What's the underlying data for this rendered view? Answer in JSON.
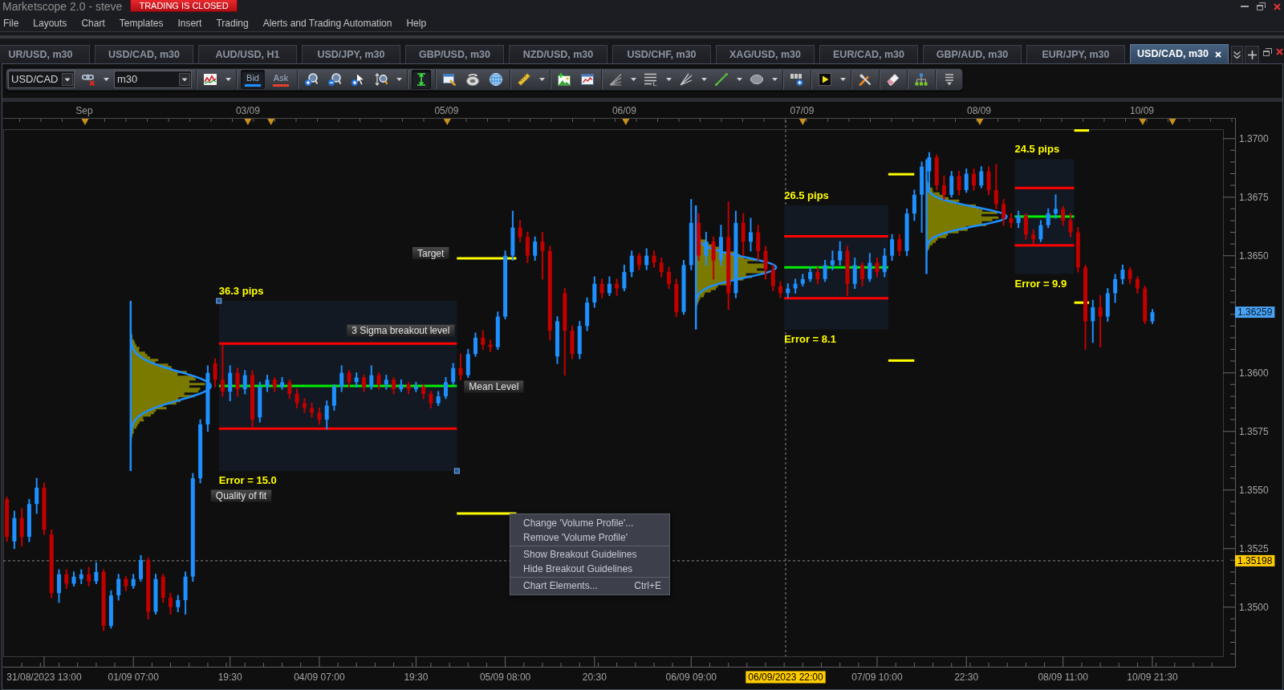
{
  "window": {
    "title": "Marketscope 2.0 - steve",
    "status_badge": "TRADING IS CLOSED"
  },
  "menu": [
    "File",
    "Layouts",
    "Chart",
    "Templates",
    "Insert",
    "Trading",
    "Alerts and Trading Automation",
    "Help"
  ],
  "tabs": [
    {
      "label": "UR/USD, m30",
      "selected": false
    },
    {
      "label": "USD/CAD, m30",
      "selected": false
    },
    {
      "label": "AUD/USD, H1",
      "selected": false
    },
    {
      "label": "USD/JPY, m30",
      "selected": false
    },
    {
      "label": "GBP/USD, m30",
      "selected": false
    },
    {
      "label": "NZD/USD, m30",
      "selected": false
    },
    {
      "label": "USD/CHF, m30",
      "selected": false
    },
    {
      "label": "XAG/USD, m30",
      "selected": false
    },
    {
      "label": "EUR/CAD, m30",
      "selected": false
    },
    {
      "label": "GBP/AUD, m30",
      "selected": false
    },
    {
      "label": "EUR/JPY, m30",
      "selected": false
    },
    {
      "label": "USD/CAD, m30",
      "selected": true
    }
  ],
  "toolbar": {
    "symbol": "USD/CAD",
    "timeframe": "m30",
    "price_modes": [
      {
        "label": "Bid",
        "selected": true,
        "color": "#1e90ff"
      },
      {
        "label": "Ask",
        "selected": false,
        "color": "#e8402a"
      }
    ],
    "vertical_fit_on": true
  },
  "chart": {
    "date_ruler": [
      "Sep",
      "03/09",
      "05/09",
      "06/09",
      "07/09",
      "08/09",
      "10/09"
    ],
    "chart_data": [
      {
        "type": "candlestick",
        "ylim": [
          1.3479,
          1.3704
        ],
        "yticks": [
          {
            "value": 1.35,
            "label": "1.3500"
          },
          {
            "value": 1.3525,
            "label": "1.3525"
          },
          {
            "value": 1.355,
            "label": "1.3550"
          },
          {
            "value": 1.3575,
            "label": "1.3575"
          },
          {
            "value": 1.36,
            "label": "1.3600"
          },
          {
            "value": 1.365,
            "label": "1.3650"
          },
          {
            "value": 1.3675,
            "label": "1.3675"
          },
          {
            "value": 1.37,
            "label": "1.3700"
          }
        ],
        "categories": [
          null,
          null,
          null,
          null,
          null,
          "31/08/2023 13:00",
          null,
          null,
          null,
          null,
          null,
          null,
          null,
          null,
          null,
          null,
          null,
          "01/09 07:00",
          null,
          null,
          null,
          null,
          null,
          null,
          null,
          null,
          null,
          null,
          null,
          null,
          "19:30",
          null,
          null,
          null,
          null,
          null,
          null,
          null,
          null,
          null,
          null,
          null,
          "04/09 07:00",
          null,
          null,
          null,
          null,
          null,
          null,
          null,
          null,
          null,
          null,
          null,
          null,
          "19:30",
          null,
          null,
          null,
          null,
          null,
          null,
          null,
          null,
          null,
          null,
          null,
          "05/09 08:00",
          null,
          null,
          null,
          null,
          null,
          null,
          null,
          null,
          null,
          null,
          null,
          "20:30",
          null,
          null,
          null,
          null,
          null,
          null,
          null,
          null,
          null,
          null,
          null,
          null,
          "06/09 09:00",
          null,
          null,
          null,
          null,
          null,
          null,
          null,
          null,
          null,
          null,
          null,
          null,
          null,
          null,
          null,
          null,
          null,
          null,
          null,
          null,
          null,
          null,
          null,
          null,
          "07/09 10:00",
          null,
          null,
          null,
          null,
          null,
          null,
          null,
          null,
          null,
          null,
          null,
          "22:30",
          null,
          null,
          null,
          null,
          null,
          null,
          null,
          null,
          null,
          null,
          null,
          null,
          "08/09 11:00",
          null,
          null,
          null,
          null,
          null,
          null,
          null,
          null,
          null,
          null,
          null,
          "10/09 21:30",
          null,
          null,
          null,
          null,
          null,
          null,
          null,
          null,
          null
        ],
        "ref_lines": [
          {
            "axis": "y",
            "value": 1.35198,
            "label": "1.35198",
            "line_style": "dashed"
          },
          {
            "axis": "y",
            "value": 1.36125,
            "color": "#ff0000"
          },
          {
            "axis": "y",
            "value": 1.35944,
            "color": "#00ee00"
          },
          {
            "axis": "y",
            "value": 1.35762,
            "color": "#ff0000"
          },
          {
            "axis": "y",
            "value": 1.36583,
            "color": "#ff0000"
          },
          {
            "axis": "y",
            "value": 1.3645,
            "color": "#00ee00"
          },
          {
            "axis": "y",
            "value": 1.36318,
            "color": "#ff0000"
          }
        ],
        "ohlc": [
          [
            1.3546,
            1.3547,
            1.3528,
            1.353
          ],
          [
            1.3528,
            1.3541,
            1.3525,
            1.3538
          ],
          [
            1.3538,
            1.3542,
            1.3526,
            1.353
          ],
          [
            1.353,
            1.3546,
            1.3528,
            1.3544
          ],
          [
            1.3544,
            1.3555,
            1.354,
            1.3551
          ],
          [
            1.3551,
            1.3553,
            1.3531,
            1.3533
          ],
          [
            1.3531,
            1.3533,
            1.3504,
            1.3506
          ],
          [
            1.3506,
            1.3516,
            1.3502,
            1.3514
          ],
          [
            1.3514,
            1.3516,
            1.3508,
            1.351
          ],
          [
            1.351,
            1.3515,
            1.3509,
            1.3513
          ],
          [
            1.3512,
            1.3516,
            1.351,
            1.3514
          ],
          [
            1.3514,
            1.3517,
            1.3509,
            1.3511
          ],
          [
            1.3511,
            1.3519,
            1.351,
            1.3515
          ],
          [
            1.3515,
            1.3516,
            1.349,
            1.3492
          ],
          [
            1.3492,
            1.3507,
            1.3491,
            1.3505
          ],
          [
            1.3505,
            1.3514,
            1.3503,
            1.3512
          ],
          [
            1.3512,
            1.3513,
            1.3507,
            1.3509
          ],
          [
            1.3509,
            1.3514,
            1.3508,
            1.3512
          ],
          [
            1.3512,
            1.3522,
            1.3511,
            1.352
          ],
          [
            1.352,
            1.3521,
            1.3495,
            1.3498
          ],
          [
            1.3498,
            1.3514,
            1.3497,
            1.3512
          ],
          [
            1.3513,
            1.3514,
            1.3502,
            1.3504
          ],
          [
            1.3504,
            1.3506,
            1.3497,
            1.35
          ],
          [
            1.35,
            1.3505,
            1.3498,
            1.3503
          ],
          [
            1.3503,
            1.3515,
            1.3497,
            1.3513
          ],
          [
            1.3513,
            1.3557,
            1.3511,
            1.3555
          ],
          [
            1.3555,
            1.358,
            1.3553,
            1.3578
          ],
          [
            1.3578,
            1.3603,
            1.3575,
            1.36
          ],
          [
            1.3604,
            1.3606,
            1.3594,
            1.3597
          ],
          [
            1.3597,
            1.3612,
            1.359,
            1.3592
          ],
          [
            1.3592,
            1.3603,
            1.3588,
            1.36
          ],
          [
            1.36,
            1.3602,
            1.359,
            1.3593
          ],
          [
            1.3593,
            1.3601,
            1.3591,
            1.3599
          ],
          [
            1.3599,
            1.3601,
            1.3577,
            1.358
          ],
          [
            1.3581,
            1.3596,
            1.3579,
            1.3594
          ],
          [
            1.3594,
            1.3599,
            1.3592,
            1.3597
          ],
          [
            1.3597,
            1.3598,
            1.3592,
            1.3594
          ],
          [
            1.3594,
            1.3598,
            1.3593,
            1.3596
          ],
          [
            1.3596,
            1.3597,
            1.3589,
            1.3591
          ],
          [
            1.3591,
            1.3593,
            1.3585,
            1.3587
          ],
          [
            1.3587,
            1.3589,
            1.3583,
            1.3585
          ],
          [
            1.3585,
            1.3587,
            1.3581,
            1.3583
          ],
          [
            1.3583,
            1.3585,
            1.3578,
            1.358
          ],
          [
            1.358,
            1.3588,
            1.3576,
            1.3586
          ],
          [
            1.3586,
            1.3595,
            1.3584,
            1.3594
          ],
          [
            1.3594,
            1.3603,
            1.3592,
            1.36
          ],
          [
            1.36,
            1.3601,
            1.3594,
            1.3596
          ],
          [
            1.3596,
            1.36,
            1.3594,
            1.3598
          ],
          [
            1.3598,
            1.3599,
            1.3592,
            1.3594
          ],
          [
            1.3594,
            1.3603,
            1.3593,
            1.3599
          ],
          [
            1.3599,
            1.36,
            1.3593,
            1.3595
          ],
          [
            1.3595,
            1.3599,
            1.3593,
            1.3597
          ],
          [
            1.3597,
            1.3598,
            1.3591,
            1.3593
          ],
          [
            1.3593,
            1.3597,
            1.3592,
            1.3595
          ],
          [
            1.3595,
            1.3596,
            1.3591,
            1.3593
          ],
          [
            1.3593,
            1.3596,
            1.3592,
            1.3594
          ],
          [
            1.3594,
            1.3595,
            1.3589,
            1.3591
          ],
          [
            1.3591,
            1.3592,
            1.3585,
            1.3587
          ],
          [
            1.3587,
            1.3592,
            1.3586,
            1.359
          ],
          [
            1.359,
            1.3598,
            1.3589,
            1.3596
          ],
          [
            1.3596,
            1.3604,
            1.3595,
            1.3602
          ],
          [
            1.3602,
            1.3608,
            1.3597,
            1.3599
          ],
          [
            1.3599,
            1.361,
            1.3598,
            1.3608
          ],
          [
            1.3608,
            1.3617,
            1.3607,
            1.3615
          ],
          [
            1.3615,
            1.3618,
            1.361,
            1.3612
          ],
          [
            1.3612,
            1.3614,
            1.3609,
            1.3611
          ],
          [
            1.3611,
            1.3626,
            1.361,
            1.3624
          ],
          [
            1.3624,
            1.3652,
            1.3623,
            1.365
          ],
          [
            1.365,
            1.3669,
            1.3648,
            1.3662
          ],
          [
            1.3662,
            1.3665,
            1.3656,
            1.3658
          ],
          [
            1.3658,
            1.366,
            1.3647,
            1.365
          ],
          [
            1.365,
            1.3658,
            1.3648,
            1.3656
          ],
          [
            1.3656,
            1.366,
            1.364,
            1.3652
          ],
          [
            1.3652,
            1.3654,
            1.3614,
            1.3618
          ],
          [
            1.3607,
            1.3624,
            1.3604,
            1.3622
          ],
          [
            1.3634,
            1.3636,
            1.3599,
            1.3618
          ],
          [
            1.3618,
            1.362,
            1.3606,
            1.3608
          ],
          [
            1.3608,
            1.3622,
            1.3606,
            1.362
          ],
          [
            1.362,
            1.3632,
            1.3618,
            1.363
          ],
          [
            1.363,
            1.3641,
            1.3628,
            1.3638
          ],
          [
            1.3638,
            1.364,
            1.3632,
            1.3634
          ],
          [
            1.3634,
            1.3641,
            1.3633,
            1.3638
          ],
          [
            1.3638,
            1.364,
            1.3633,
            1.3636
          ],
          [
            1.3636,
            1.3646,
            1.3635,
            1.3643
          ],
          [
            1.3643,
            1.3652,
            1.3641,
            1.365
          ],
          [
            1.365,
            1.3651,
            1.3644,
            1.3646
          ],
          [
            1.3646,
            1.3653,
            1.3644,
            1.365
          ],
          [
            1.365,
            1.3652,
            1.3645,
            1.3647
          ],
          [
            1.3647,
            1.3649,
            1.3641,
            1.3643
          ],
          [
            1.3643,
            1.3645,
            1.3636,
            1.3638
          ],
          [
            1.3638,
            1.364,
            1.3624,
            1.3626
          ],
          [
            1.3626,
            1.3648,
            1.3625,
            1.3646
          ],
          [
            1.3646,
            1.3674,
            1.3644,
            1.3664
          ],
          [
            1.3664,
            1.3668,
            1.3648,
            1.365
          ],
          [
            1.365,
            1.366,
            1.3646,
            1.3656
          ],
          [
            1.3656,
            1.3658,
            1.364,
            1.3648
          ],
          [
            1.3648,
            1.3663,
            1.3646,
            1.3658
          ],
          [
            1.3658,
            1.3673,
            1.3627,
            1.3634
          ],
          [
            1.3634,
            1.3669,
            1.3632,
            1.3664
          ],
          [
            1.3664,
            1.3668,
            1.365,
            1.3656
          ],
          [
            1.3656,
            1.3666,
            1.3652,
            1.366
          ],
          [
            1.366,
            1.3663,
            1.3648,
            1.3652
          ],
          [
            1.3652,
            1.3654,
            1.364,
            1.3644
          ],
          [
            1.3644,
            1.3646,
            1.3635,
            1.3637
          ],
          [
            1.3637,
            1.3639,
            1.3632,
            1.3634
          ],
          [
            1.3634,
            1.3638,
            1.3632,
            1.3636
          ],
          [
            1.3636,
            1.364,
            1.3634,
            1.3638
          ],
          [
            1.3638,
            1.3642,
            1.3637,
            1.364
          ],
          [
            1.364,
            1.3645,
            1.3639,
            1.3643
          ],
          [
            1.3643,
            1.3645,
            1.3638,
            1.364
          ],
          [
            1.364,
            1.3648,
            1.3639,
            1.3646
          ],
          [
            1.3646,
            1.3652,
            1.3644,
            1.3648
          ],
          [
            1.3648,
            1.3656,
            1.3646,
            1.3652
          ],
          [
            1.3652,
            1.3654,
            1.3633,
            1.3638
          ],
          [
            1.3638,
            1.3649,
            1.3636,
            1.3646
          ],
          [
            1.3646,
            1.3647,
            1.3637,
            1.364
          ],
          [
            1.364,
            1.3651,
            1.3639,
            1.3647
          ],
          [
            1.3647,
            1.3649,
            1.3641,
            1.3643
          ],
          [
            1.3643,
            1.3653,
            1.3641,
            1.365
          ],
          [
            1.365,
            1.3659,
            1.3648,
            1.3657
          ],
          [
            1.3657,
            1.3659,
            1.365,
            1.3652
          ],
          [
            1.3652,
            1.367,
            1.365,
            1.3668
          ],
          [
            1.3668,
            1.3678,
            1.3665,
            1.3676
          ],
          [
            1.3676,
            1.369,
            1.366,
            1.3688
          ],
          [
            1.3686,
            1.3694,
            1.3678,
            1.3692
          ],
          [
            1.3692,
            1.3693,
            1.3678,
            1.368
          ],
          [
            1.368,
            1.3684,
            1.3674,
            1.3676
          ],
          [
            1.3676,
            1.3686,
            1.3675,
            1.3684
          ],
          [
            1.3684,
            1.3686,
            1.3676,
            1.3678
          ],
          [
            1.3678,
            1.3687,
            1.3677,
            1.3685
          ],
          [
            1.3685,
            1.3687,
            1.3678,
            1.368
          ],
          [
            1.368,
            1.3688,
            1.3679,
            1.3686
          ],
          [
            1.3686,
            1.3688,
            1.3676,
            1.3678
          ],
          [
            1.3678,
            1.3689,
            1.367,
            1.3672
          ],
          [
            1.3672,
            1.3674,
            1.3663,
            1.3666
          ],
          [
            1.3666,
            1.3668,
            1.3662,
            1.3664
          ],
          [
            1.3664,
            1.3669,
            1.3662,
            1.3667
          ],
          [
            1.3667,
            1.3668,
            1.3657,
            1.3659
          ],
          [
            1.3659,
            1.3661,
            1.3655,
            1.3657
          ],
          [
            1.3657,
            1.3665,
            1.3656,
            1.3663
          ],
          [
            1.3663,
            1.367,
            1.3662,
            1.3668
          ],
          [
            1.3668,
            1.3676,
            1.3666,
            1.367
          ],
          [
            1.367,
            1.3671,
            1.3663,
            1.3665
          ],
          [
            1.3665,
            1.3668,
            1.3658,
            1.366
          ],
          [
            1.366,
            1.3662,
            1.3643,
            1.3645
          ],
          [
            1.3645,
            1.3646,
            1.361,
            1.3622
          ],
          [
            1.3622,
            1.3631,
            1.3613,
            1.3628
          ],
          [
            1.3628,
            1.3633,
            1.3611,
            1.3624
          ],
          [
            1.3624,
            1.3636,
            1.3622,
            1.3634
          ],
          [
            1.3634,
            1.3642,
            1.363,
            1.364
          ],
          [
            1.364,
            1.3646,
            1.3638,
            1.3644
          ],
          [
            1.3644,
            1.3645,
            1.3638,
            1.364
          ],
          [
            1.364,
            1.3641,
            1.3634,
            1.3636
          ],
          [
            1.3636,
            1.3637,
            1.3621,
            1.3622
          ],
          [
            1.3622,
            1.3627,
            1.3621,
            1.36259
          ],
          null,
          null,
          null,
          null,
          null,
          null,
          null,
          null,
          null
        ]
      }
    ],
    "crosshair_time": "06/09/2023 22:00",
    "last_price_tag": "1.36259",
    "studies": [
      {
        "range_label": "36.3 pips",
        "error_label": "Error = 15.0",
        "selected": true,
        "callouts": [
          {
            "kind": "target",
            "text": "Target"
          },
          {
            "kind": "breakout",
            "text": "3 Sigma breakout level"
          },
          {
            "kind": "mean",
            "text": "Mean Level"
          },
          {
            "kind": "fit",
            "text": "Quality of fit"
          }
        ]
      },
      {
        "range_label": "26.5 pips",
        "error_label": "Error = 8.1",
        "selected": false
      },
      {
        "range_label": "24.5 pips",
        "error_label": "Error = 9.9",
        "selected": false
      }
    ]
  },
  "context_menu": {
    "groups": [
      [
        {
          "label": "Change 'Volume Profile'..."
        },
        {
          "label": "Remove 'Volume Profile'"
        }
      ],
      [
        {
          "label": "Show Breakout Guidelines"
        },
        {
          "label": "Hide Breakout Guidelines"
        }
      ],
      [
        {
          "label": "Chart Elements...",
          "shortcut": "Ctrl+E"
        }
      ]
    ]
  }
}
